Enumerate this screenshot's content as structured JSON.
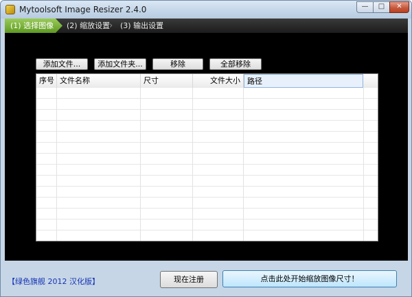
{
  "window": {
    "title": "Mytoolsoft Image Resizer 2.4.0",
    "controls": {
      "minimize": "—",
      "maximize": "□",
      "close": "✕"
    }
  },
  "tabs": [
    {
      "label": "(1) 选择图像",
      "active": true
    },
    {
      "label": "(2) 缩放设置",
      "active": false
    },
    {
      "label": "(3) 输出设置",
      "active": false
    }
  ],
  "toolbar": {
    "add_file": "添加文件...",
    "add_folder": "添加文件夹...",
    "remove": "移除",
    "remove_all": "全部移除"
  },
  "table": {
    "columns": [
      "序号",
      "文件名称",
      "尺寸",
      "文件大小",
      "路径"
    ],
    "rows": []
  },
  "footer": {
    "credit": "【绿色旗舰 2012 汉化版】",
    "register_button": "现在注册",
    "start_button": "点击此处开始缩放图像尺寸！"
  },
  "colors": {
    "active_tab": "#6aa52a",
    "panel_background": "#000000",
    "window_frame": "#c6d6e6",
    "credit_text": "#1533b5"
  }
}
